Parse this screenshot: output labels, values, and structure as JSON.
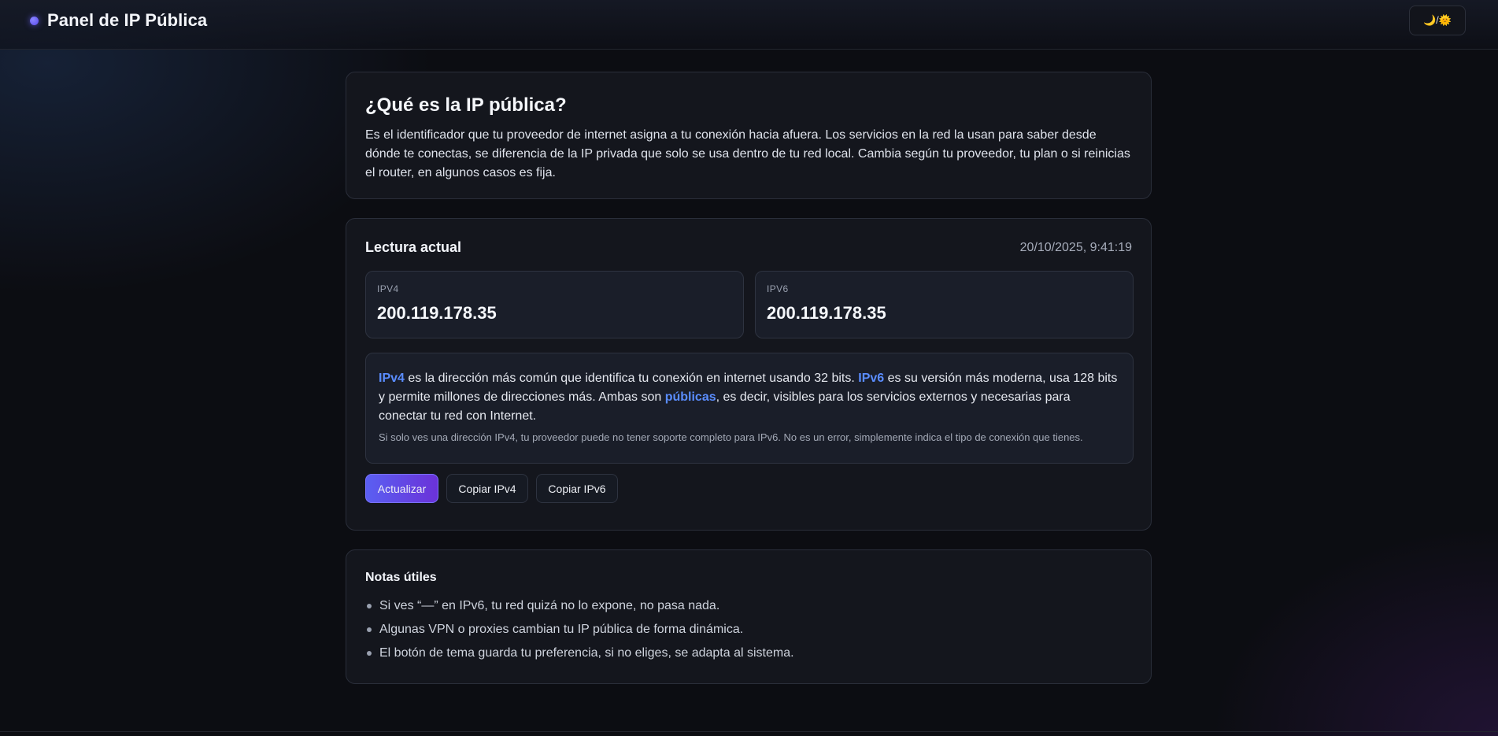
{
  "header": {
    "title": "Panel de IP Pública",
    "theme_toggle_label": "🌙/🌞"
  },
  "intro": {
    "heading": "¿Qué es la IP pública?",
    "paragraph": "Es el identificador que tu proveedor de internet asigna a tu conexión hacia afuera. Los servicios en la red la usan para saber desde dónde te conectas, se diferencia de la IP privada que solo se usa dentro de tu red local. Cambia según tu proveedor, tu plan o si reinicias el router, en algunos casos es fija."
  },
  "reading": {
    "title": "Lectura actual",
    "timestamp": "20/10/2025, 9:41:19",
    "ipv4": {
      "label": "IPV4",
      "value": "200.119.178.35"
    },
    "ipv6": {
      "label": "IPV6",
      "value": "200.119.178.35"
    },
    "info": {
      "ipv4_term": "IPv4",
      "part1": " es la dirección más común que identifica tu conexión en internet usando 32 bits. ",
      "ipv6_term": "IPv6",
      "part2": " es su versión más moderna, usa 128 bits y permite millones de direcciones más. Ambas son ",
      "public_term": "públicas",
      "part3": ", es decir, visibles para los servicios externos y necesarias para conectar tu red con Internet.",
      "note": "Si solo ves una dirección IPv4, tu proveedor puede no tener soporte completo para IPv6. No es un error, simplemente indica el tipo de conexión que tienes."
    },
    "buttons": {
      "refresh": "Actualizar",
      "copy_ipv4": "Copiar IPv4",
      "copy_ipv6": "Copiar IPv6"
    }
  },
  "notes": {
    "title": "Notas útiles",
    "items": [
      "Si ves “—” en IPv6, tu red quizá no lo expone, no pasa nada.",
      "Algunas VPN o proxies cambian tu IP pública de forma dinámica.",
      "El botón de tema guarda tu preferencia, si no eliges, se adapta al sistema."
    ]
  },
  "colors": {
    "accent": "#5a8dff",
    "primary_button_start": "#5a5ff2",
    "primary_button_end": "#6b32d8",
    "background": "#0c0d12",
    "card": "#14161d"
  }
}
